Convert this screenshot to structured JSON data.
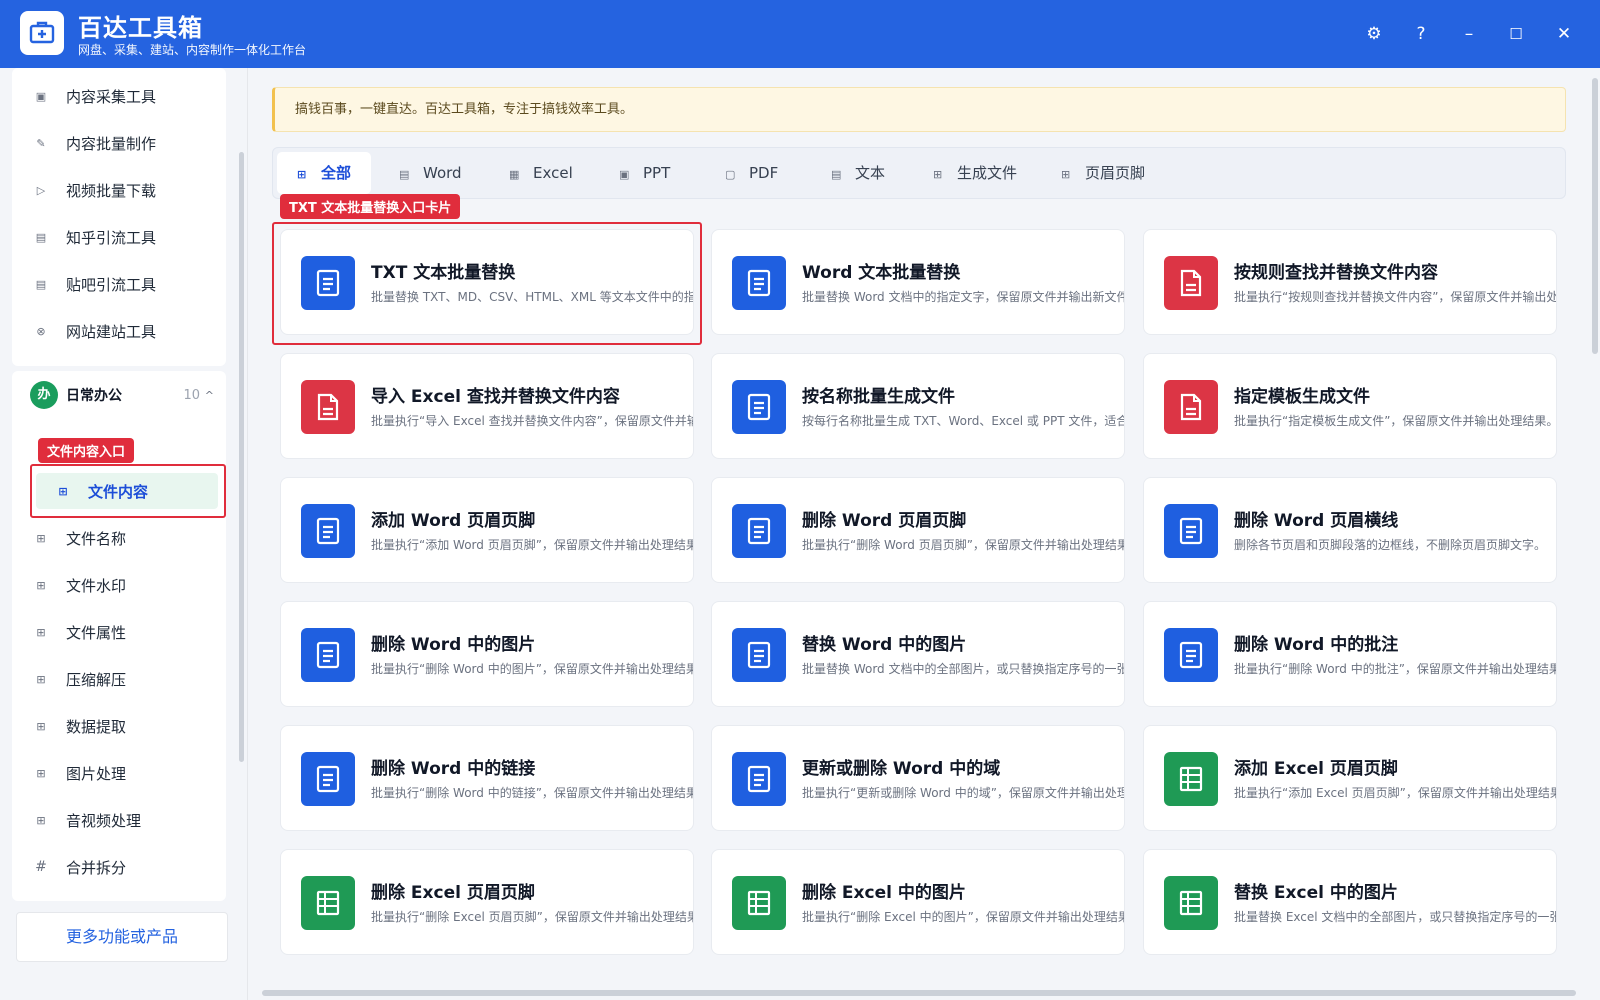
{
  "app": {
    "title": "百达工具箱",
    "subtitle": "网盘、采集、建站、内容制作一体化工作台"
  },
  "window_controls": {
    "settings": "⚙",
    "help": "?",
    "minimize": "–",
    "maximize": "☐",
    "close": "✕"
  },
  "sidebar": {
    "top_items": [
      {
        "label": "内容采集工具",
        "icon": "collect-icon"
      },
      {
        "label": "内容批量制作",
        "icon": "edit-icon"
      },
      {
        "label": "视频批量下载",
        "icon": "video-icon"
      },
      {
        "label": "知乎引流工具",
        "icon": "zhihu-icon"
      },
      {
        "label": "贴吧引流工具",
        "icon": "tieba-icon"
      },
      {
        "label": "网站建站工具",
        "icon": "website-icon"
      }
    ],
    "group": {
      "badge": "办",
      "title": "日常办公",
      "count": "10",
      "caret": "^"
    },
    "annotation": "文件内容入口",
    "items": [
      {
        "label": "文件内容",
        "icon": "grid-icon"
      },
      {
        "label": "文件名称",
        "icon": "grid-icon"
      },
      {
        "label": "文件水印",
        "icon": "grid-icon"
      },
      {
        "label": "文件属性",
        "icon": "grid-icon"
      },
      {
        "label": "压缩解压",
        "icon": "grid-icon"
      },
      {
        "label": "数据提取",
        "icon": "grid-icon"
      },
      {
        "label": "图片处理",
        "icon": "grid-icon"
      },
      {
        "label": "音视频处理",
        "icon": "grid-icon"
      },
      {
        "label": "合并拆分",
        "icon": "hash-icon"
      }
    ],
    "more_button": "更多功能或产品"
  },
  "notice": "搞钱百事，一键直达。百达工具箱，专注于搞钱效率工具。",
  "tabs": [
    "全部",
    "Word",
    "Excel",
    "PPT",
    "PDF",
    "文本",
    "生成文件",
    "页眉页脚"
  ],
  "card_annotation": "TXT 文本批量替换入口卡片",
  "cards": [
    {
      "title": "TXT 文本批量替换",
      "desc": "批量替换 TXT、MD、CSV、HTML、XML 等文本文件中的指定内容",
      "color": "blue",
      "icon": "doc-icon"
    },
    {
      "title": "Word 文本批量替换",
      "desc": "批量替换 Word 文档中的指定文字，保留原文件并输出新文件。",
      "color": "blue",
      "icon": "doc-icon"
    },
    {
      "title": "按规则查找并替换文件内容",
      "desc": "批量执行“按规则查找并替换文件内容”，保留原文件并输出处理结果",
      "color": "red",
      "icon": "pdf-icon"
    },
    {
      "title": "导入 Excel 查找并替换文件内容",
      "desc": "批量执行“导入 Excel 查找并替换文件内容”，保留原文件并输出处理结果",
      "color": "red",
      "icon": "pdf-icon"
    },
    {
      "title": "按名称批量生成文件",
      "desc": "按每行名称批量生成 TXT、Word、Excel 或 PPT 文件，适合批量创建",
      "color": "blue",
      "icon": "doc-icon"
    },
    {
      "title": "指定模板生成文件",
      "desc": "批量执行“指定模板生成文件”，保留原文件并输出处理结果。",
      "color": "red",
      "icon": "pdf-icon"
    },
    {
      "title": "添加 Word 页眉页脚",
      "desc": "批量执行“添加 Word 页眉页脚”，保留原文件并输出处理结果。",
      "color": "blue",
      "icon": "doc-icon"
    },
    {
      "title": "删除 Word 页眉页脚",
      "desc": "批量执行“删除 Word 页眉页脚”，保留原文件并输出处理结果。",
      "color": "blue",
      "icon": "doc-icon"
    },
    {
      "title": "删除 Word 页眉横线",
      "desc": "删除各节页眉和页脚段落的边框线，不删除页眉页脚文字。",
      "color": "blue",
      "icon": "doc-icon"
    },
    {
      "title": "删除 Word 中的图片",
      "desc": "批量执行“删除 Word 中的图片”，保留原文件并输出处理结果。",
      "color": "blue",
      "icon": "doc-icon"
    },
    {
      "title": "替换 Word 中的图片",
      "desc": "批量替换 Word 文档中的全部图片，或只替换指定序号的一张图片。",
      "color": "blue",
      "icon": "doc-icon"
    },
    {
      "title": "删除 Word 中的批注",
      "desc": "批量执行“删除 Word 中的批注”，保留原文件并输出处理结果。",
      "color": "blue",
      "icon": "doc-icon"
    },
    {
      "title": "删除 Word 中的链接",
      "desc": "批量执行“删除 Word 中的链接”，保留原文件并输出处理结果。",
      "color": "blue",
      "icon": "doc-icon"
    },
    {
      "title": "更新或删除 Word 中的域",
      "desc": "批量执行“更新或删除 Word 中的域”，保留原文件并输出处理结果。",
      "color": "blue",
      "icon": "doc-icon"
    },
    {
      "title": "添加 Excel 页眉页脚",
      "desc": "批量执行“添加 Excel 页眉页脚”，保留原文件并输出处理结果。",
      "color": "green",
      "icon": "sheet-icon"
    },
    {
      "title": "删除 Excel 页眉页脚",
      "desc": "批量执行“删除 Excel 页眉页脚”，保留原文件并输出处理结果。",
      "color": "green",
      "icon": "sheet-icon"
    },
    {
      "title": "删除 Excel 中的图片",
      "desc": "批量执行“删除 Excel 中的图片”，保留原文件并输出处理结果。",
      "color": "green",
      "icon": "sheet-icon"
    },
    {
      "title": "替换 Excel 中的图片",
      "desc": "批量替换 Excel 文档中的全部图片，或只替换指定序号的一张图片。",
      "color": "green",
      "icon": "sheet-icon"
    }
  ],
  "colors": {
    "primary": "#2563e0",
    "doc_blue": "#1f5fe0",
    "pdf_red": "#dc3545",
    "sheet_green": "#1f9a55",
    "annotation_red": "#e02d3c"
  }
}
